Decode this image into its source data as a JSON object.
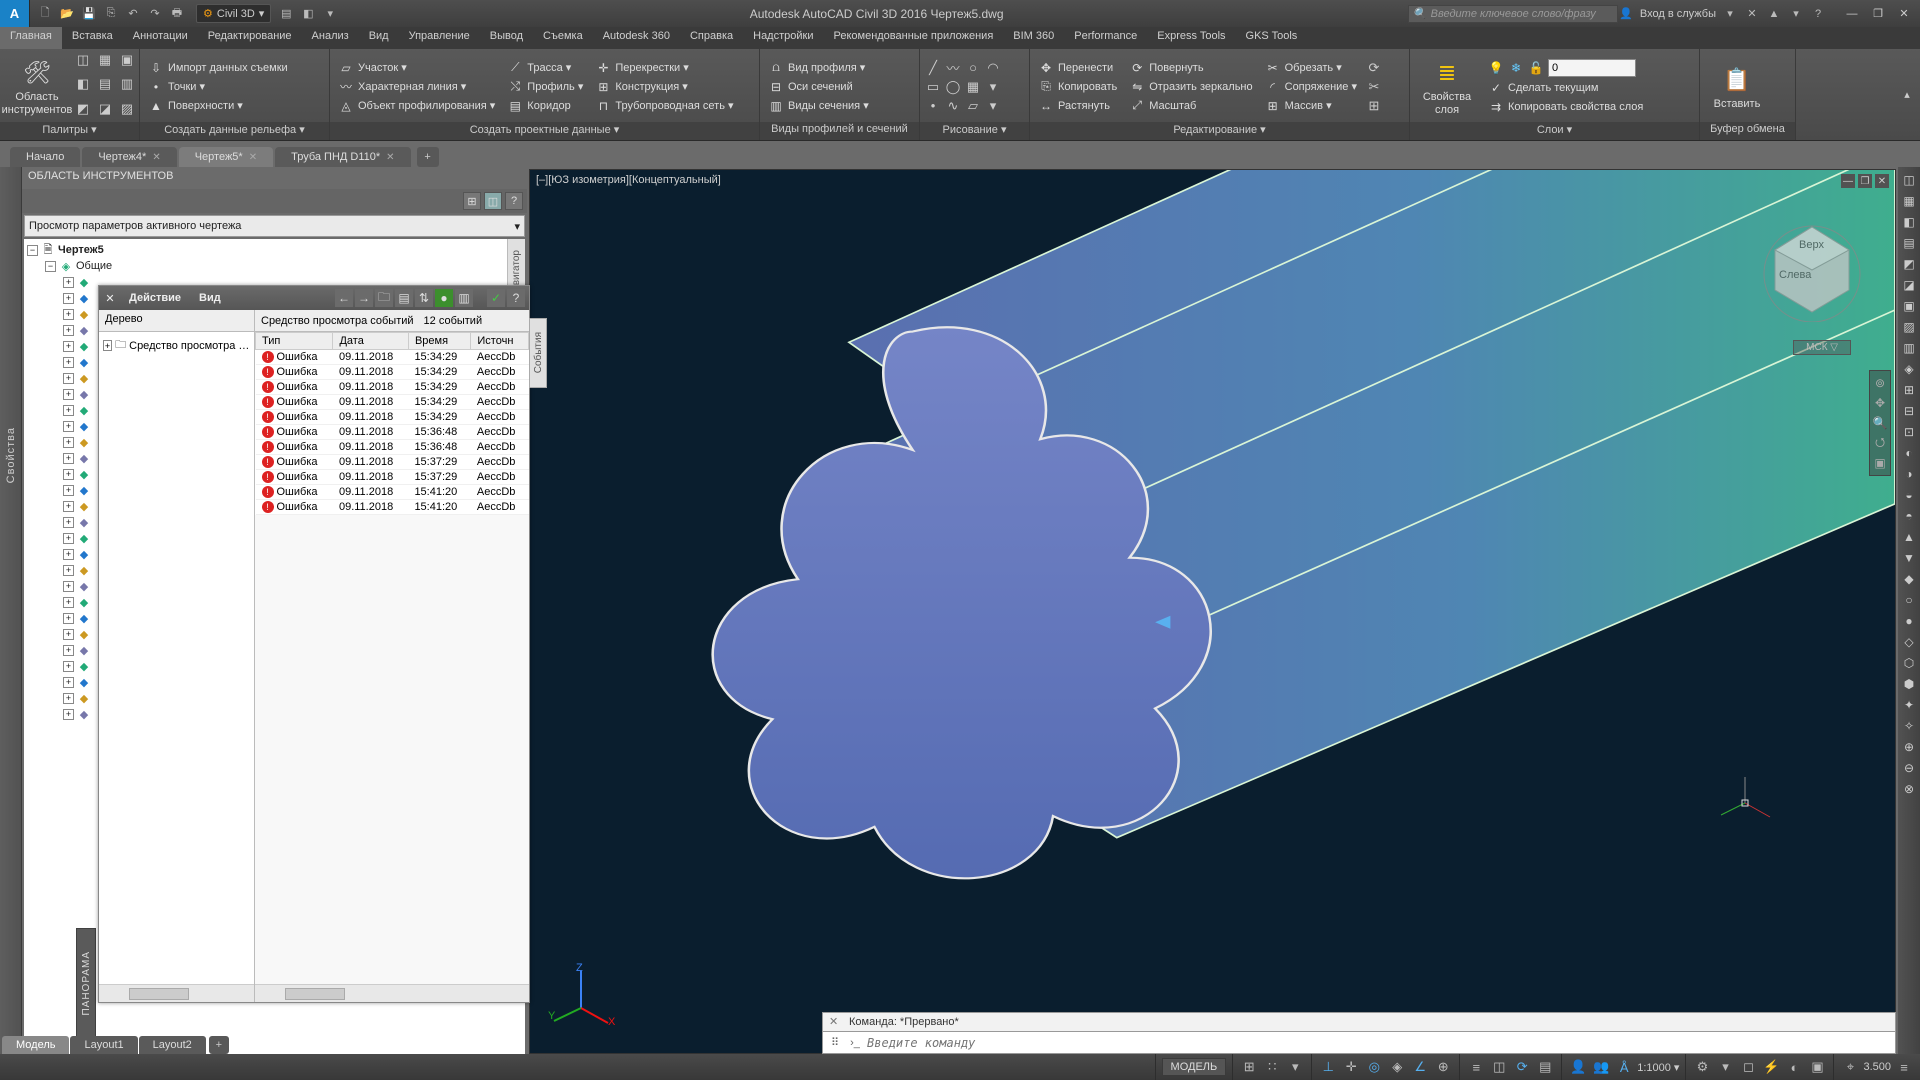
{
  "app": {
    "logo": "A",
    "workspace": "Civil 3D",
    "title": "Autodesk AutoCAD Civil 3D 2016   Чертеж5.dwg",
    "search_placeholder": "Введите ключевое слово/фразу",
    "signin": "Вход в службы"
  },
  "menu": [
    "Главная",
    "Вставка",
    "Аннотации",
    "Редактирование",
    "Анализ",
    "Вид",
    "Управление",
    "Вывод",
    "Съемка",
    "Autodesk 360",
    "Справка",
    "Надстройки",
    "Рекомендованные приложения",
    "BIM 360",
    "Performance",
    "Express Tools",
    "GKS Tools"
  ],
  "ribbon": {
    "palettes": {
      "big": "Область инструментов",
      "title": "Палитры ▾"
    },
    "groundData": {
      "items": [
        "Импорт данных съемки",
        "Точки ▾",
        "Поверхности ▾"
      ],
      "title": "Создать данные рельефа ▾"
    },
    "designData": {
      "col1": [
        "Участок ▾",
        "Характерная линия ▾",
        "Объект профилирования ▾"
      ],
      "col2": [
        "Трасса ▾",
        "Профиль ▾",
        "Коридор"
      ],
      "col3": [
        "Перекрестки ▾",
        "Конструкция ▾",
        "Трубопроводная сеть ▾"
      ],
      "title": "Создать проектные данные ▾"
    },
    "profiles": {
      "items": [
        "Вид профиля ▾",
        "Оси сечений",
        "Виды сечения ▾"
      ],
      "title": "Виды профилей и сечений"
    },
    "draw": {
      "title": "Рисование ▾"
    },
    "modify": {
      "col1": [
        "Перенести",
        "Копировать",
        "Растянуть"
      ],
      "col2": [
        "Повернуть",
        "Отразить зеркально",
        "Масштаб"
      ],
      "col3": [
        "Обрезать ▾",
        "Сопряжение ▾",
        "Массив ▾"
      ],
      "title": "Редактирование ▾"
    },
    "layers": {
      "big": "Свойства\nслоя",
      "lineweight": "0",
      "items": [
        "Сделать текущим",
        "Копировать свойства слоя"
      ],
      "title": "Слои ▾"
    },
    "clipboard": {
      "big": "Вставить",
      "title": "Буфер обмена"
    }
  },
  "doctabs": {
    "tabs": [
      {
        "label": "Начало",
        "closable": false
      },
      {
        "label": "Чертеж4*",
        "closable": true
      },
      {
        "label": "Чертеж5*",
        "closable": true,
        "active": true
      },
      {
        "label": "Труба ПНД D110*",
        "closable": true
      }
    ]
  },
  "toolspace": {
    "header": "ОБЛАСТЬ ИНСТРУМЕНТОВ",
    "combo": "Просмотр параметров активного чертежа",
    "root": "Чертеж5",
    "child": "Общие",
    "navigator_tab": "Навигатор",
    "panorama": "ПАНОРАМА",
    "left_vlabel": "Свойства"
  },
  "eventviewer": {
    "menus": [
      "Действие",
      "Вид"
    ],
    "tree_tab": "Дерево",
    "tree_item": "Средство просмотра событий",
    "caption": "Средство просмотра событий",
    "count": "12 событий",
    "columns": [
      "Тип",
      "Дата",
      "Время",
      "Источн"
    ],
    "side_tab": "События",
    "rows": [
      {
        "type": "Ошибка",
        "date": "09.11.2018",
        "time": "15:34:29",
        "src": "AeccDb"
      },
      {
        "type": "Ошибка",
        "date": "09.11.2018",
        "time": "15:34:29",
        "src": "AeccDb"
      },
      {
        "type": "Ошибка",
        "date": "09.11.2018",
        "time": "15:34:29",
        "src": "AeccDb"
      },
      {
        "type": "Ошибка",
        "date": "09.11.2018",
        "time": "15:34:29",
        "src": "AeccDb"
      },
      {
        "type": "Ошибка",
        "date": "09.11.2018",
        "time": "15:34:29",
        "src": "AeccDb"
      },
      {
        "type": "Ошибка",
        "date": "09.11.2018",
        "time": "15:36:48",
        "src": "AeccDb"
      },
      {
        "type": "Ошибка",
        "date": "09.11.2018",
        "time": "15:36:48",
        "src": "AeccDb"
      },
      {
        "type": "Ошибка",
        "date": "09.11.2018",
        "time": "15:37:29",
        "src": "AeccDb"
      },
      {
        "type": "Ошибка",
        "date": "09.11.2018",
        "time": "15:37:29",
        "src": "AeccDb"
      },
      {
        "type": "Ошибка",
        "date": "09.11.2018",
        "time": "15:41:20",
        "src": "AeccDb"
      },
      {
        "type": "Ошибка",
        "date": "09.11.2018",
        "time": "15:41:20",
        "src": "AeccDb"
      }
    ]
  },
  "viewport": {
    "label": "[–][ЮЗ изометрия][Концептуальный]",
    "wcs": "МСК ▽",
    "cube_top": "Верх",
    "cube_left": "Слева"
  },
  "command": {
    "history": "Команда: *Прервано*",
    "placeholder": "Введите команду"
  },
  "layouts": {
    "tabs": [
      "Модель",
      "Layout1",
      "Layout2"
    ],
    "active": 0
  },
  "status": {
    "model": "МОДЕЛЬ",
    "scale": "1:1000 ▾",
    "zoom": "3.500"
  }
}
